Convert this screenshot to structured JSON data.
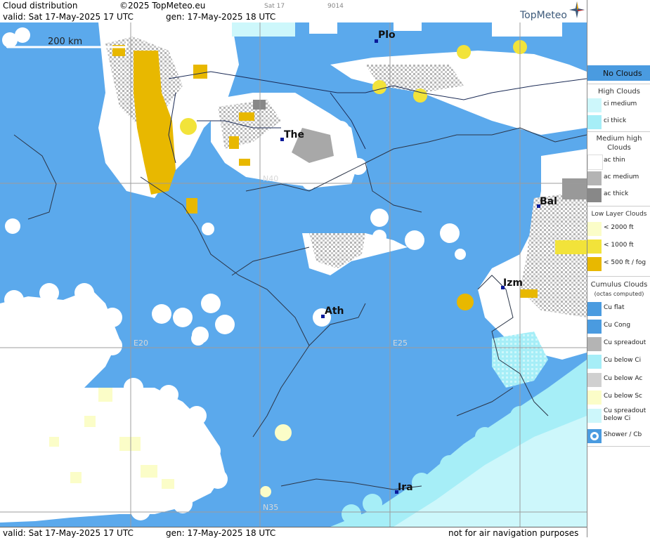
{
  "header": {
    "title": "Cloud distribution",
    "copyright": "©2025 TopMeteo.eu",
    "valid": "valid:  Sat  17-May-2025  17 UTC",
    "generated": "gen: 17-May-2025 18 UTC",
    "small_day": "Sat 17",
    "small_code": "9014",
    "logo": "TopMeteo"
  },
  "footer": {
    "valid": "valid:  Sat  17-May-2025  17 UTC",
    "generated": "gen: 17-May-2025 18 UTC",
    "disclaimer": "not for air navigation purposes"
  },
  "scale_bar": "200 km",
  "grid_labels": {
    "n40": "N40",
    "n35": "N35",
    "e20": "E20",
    "e25": "E25"
  },
  "cities": {
    "plo": "Plo",
    "the": "The",
    "bal": "Bal",
    "izm": "Izm",
    "ath": "Ath",
    "ira": "Ira"
  },
  "colors": {
    "sea": "#5ba9ec",
    "no_clouds": "#4a9be0",
    "white_cloud": "#ffffff",
    "grey_cloud": "#b4b4b4",
    "dark_grey": "#888888",
    "low_yellow": "#f2e33a",
    "low_orange": "#e8b800",
    "pale_yellow": "#fbfdc8",
    "cyan": "#a6eef7",
    "light_cyan": "#cdf7fb"
  },
  "legend": {
    "no_clouds": "No Clouds",
    "high_clouds": "High Clouds",
    "ci_medium": "ci medium",
    "ci_thick": "ci thick",
    "medium_high": "Medium high Clouds",
    "ac_thin": "ac thin",
    "ac_medium": "ac medium",
    "ac_thick": "ac thick",
    "low_layer": "Low Layer Clouds",
    "lt2000": "< 2000 ft",
    "lt1000": "< 1000 ft",
    "lt500": "< 500 ft / fog",
    "cumulus": "Cumulus Clouds",
    "octas": "(octas computed)",
    "cu_flat": "Cu flat",
    "cu_cong": "Cu Cong",
    "cu_spreadout": "Cu spreadout",
    "cu_below_ci": "Cu below Ci",
    "cu_below_ac": "Cu below Ac",
    "cu_below_sc": "Cu below Sc",
    "cu_spreadout_ci": "Cu spreadout below Ci",
    "shower_cb": "Shower / Cb"
  }
}
